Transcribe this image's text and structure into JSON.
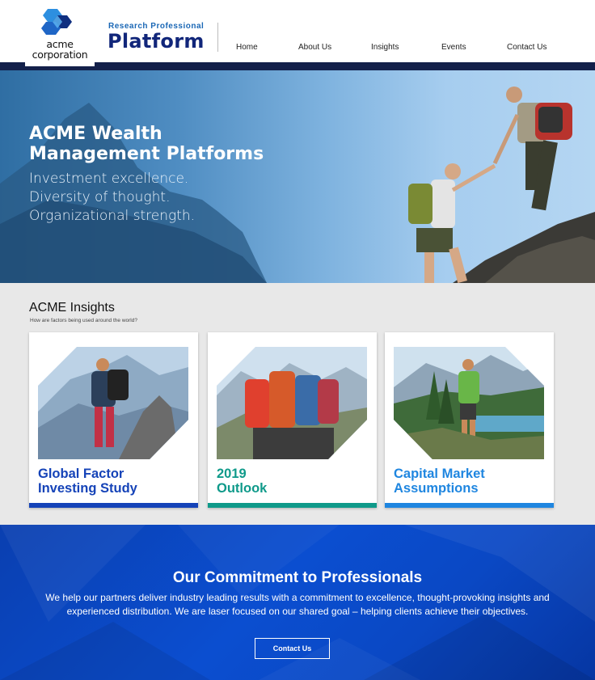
{
  "header": {
    "logo_line1": "acme",
    "logo_line2": "corporation",
    "brand_small": "Research Professional",
    "brand_big": "Platform",
    "nav": [
      {
        "label": "Home"
      },
      {
        "label": "About Us"
      },
      {
        "label": "Insights"
      },
      {
        "label": "Events"
      },
      {
        "label": "Contact Us"
      }
    ]
  },
  "hero": {
    "title": "ACME Wealth Management Platforms",
    "lines": [
      "Investment excellence.",
      "Diversity of thought.",
      "Organizational strength."
    ]
  },
  "insights": {
    "title": "ACME Insights",
    "subtitle": "How are factors being used around the world?",
    "cards": [
      {
        "title_line1": "Global Factor",
        "title_line2": "Investing Study",
        "color": "#1543b8",
        "bar_color": "#1543b8"
      },
      {
        "title_line1": "2019",
        "title_line2": "Outlook",
        "color": "#0f9a8a",
        "bar_color": "#0f9a8a"
      },
      {
        "title_line1": "Capital Market",
        "title_line2": "Assumptions",
        "color": "#1f86e0",
        "bar_color": "#1f86e0"
      }
    ]
  },
  "commitment": {
    "title": "Our Commitment to Professionals",
    "body": "We help our partners deliver industry leading results with a commitment to excellence, thought-provoking insights and experienced distribution. We are laser focused on our shared goal – helping clients achieve their objectives.",
    "button_label": "Contact Us"
  },
  "colors": {
    "navy": "#13204a",
    "brand_blue": "#11267a",
    "accent_blue": "#1a67b5",
    "commit_bg": "#0b4ed0"
  }
}
